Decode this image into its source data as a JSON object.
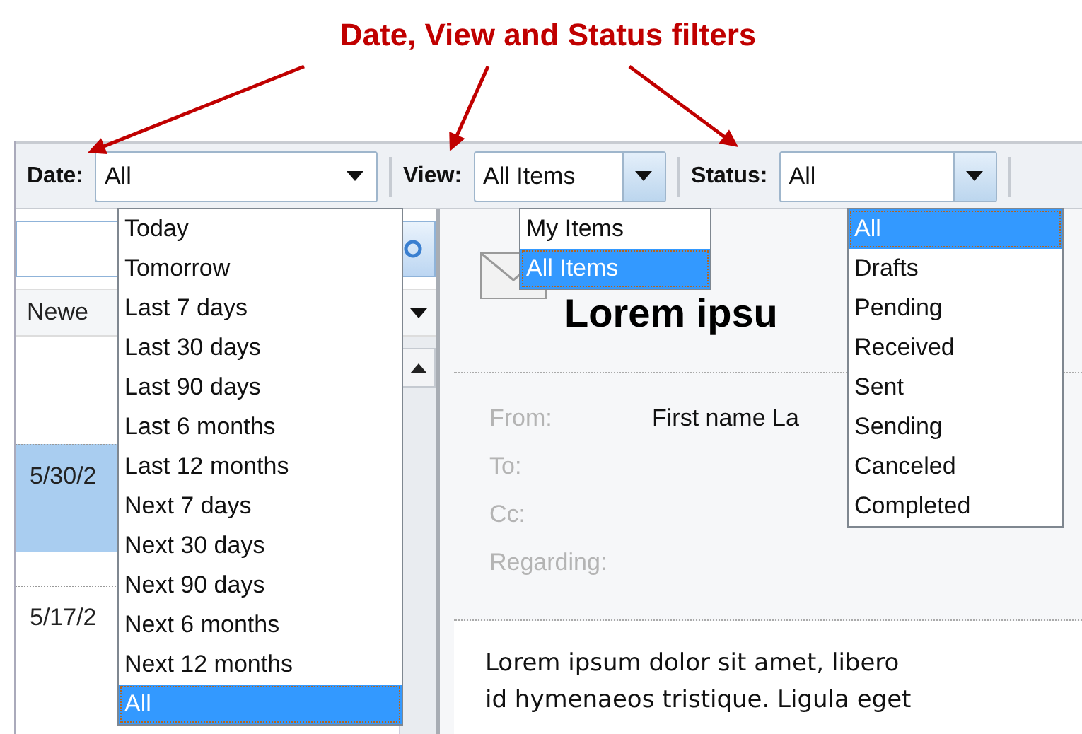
{
  "annotation": {
    "title": "Date, View and Status filters"
  },
  "toolbar": {
    "filters": [
      {
        "label": "Date:",
        "value": "All",
        "kind": "plain",
        "options": [
          {
            "label": "Today",
            "selected": false
          },
          {
            "label": "Tomorrow",
            "selected": false
          },
          {
            "label": "Last 7 days",
            "selected": false
          },
          {
            "label": "Last 30 days",
            "selected": false
          },
          {
            "label": "Last 90 days",
            "selected": false
          },
          {
            "label": "Last 6 months",
            "selected": false
          },
          {
            "label": "Last 12 months",
            "selected": false
          },
          {
            "label": "Next 7 days",
            "selected": false
          },
          {
            "label": "Next 30 days",
            "selected": false
          },
          {
            "label": "Next 90 days",
            "selected": false
          },
          {
            "label": "Next 6 months",
            "selected": false
          },
          {
            "label": "Next 12 months",
            "selected": false
          },
          {
            "label": "All",
            "selected": true
          }
        ]
      },
      {
        "label": "View:",
        "value": "All Items",
        "kind": "button",
        "options": [
          {
            "label": "My Items",
            "selected": false
          },
          {
            "label": "All Items",
            "selected": true
          }
        ]
      },
      {
        "label": "Status:",
        "value": "All",
        "kind": "button",
        "options": [
          {
            "label": "All",
            "selected": true
          },
          {
            "label": "Drafts",
            "selected": false
          },
          {
            "label": "Pending",
            "selected": false
          },
          {
            "label": "Received",
            "selected": false
          },
          {
            "label": "Sent",
            "selected": false
          },
          {
            "label": "Sending",
            "selected": false
          },
          {
            "label": "Canceled",
            "selected": false
          },
          {
            "label": "Completed",
            "selected": false
          }
        ]
      }
    ]
  },
  "list": {
    "sort_label": "Newe",
    "items": [
      {
        "date": "5/30/2",
        "selected": true
      },
      {
        "date": "5/17/2",
        "selected": false
      }
    ]
  },
  "message": {
    "title": "Lorem ipsu",
    "fields": [
      {
        "label": "From:",
        "value": "First name La"
      },
      {
        "label": "To:"
      },
      {
        "label": "Cc:"
      },
      {
        "label": "Regarding:"
      }
    ],
    "body": [
      "Lorem ipsum dolor sit amet, libero",
      "id hymenaeos tristique. Ligula eget"
    ]
  }
}
